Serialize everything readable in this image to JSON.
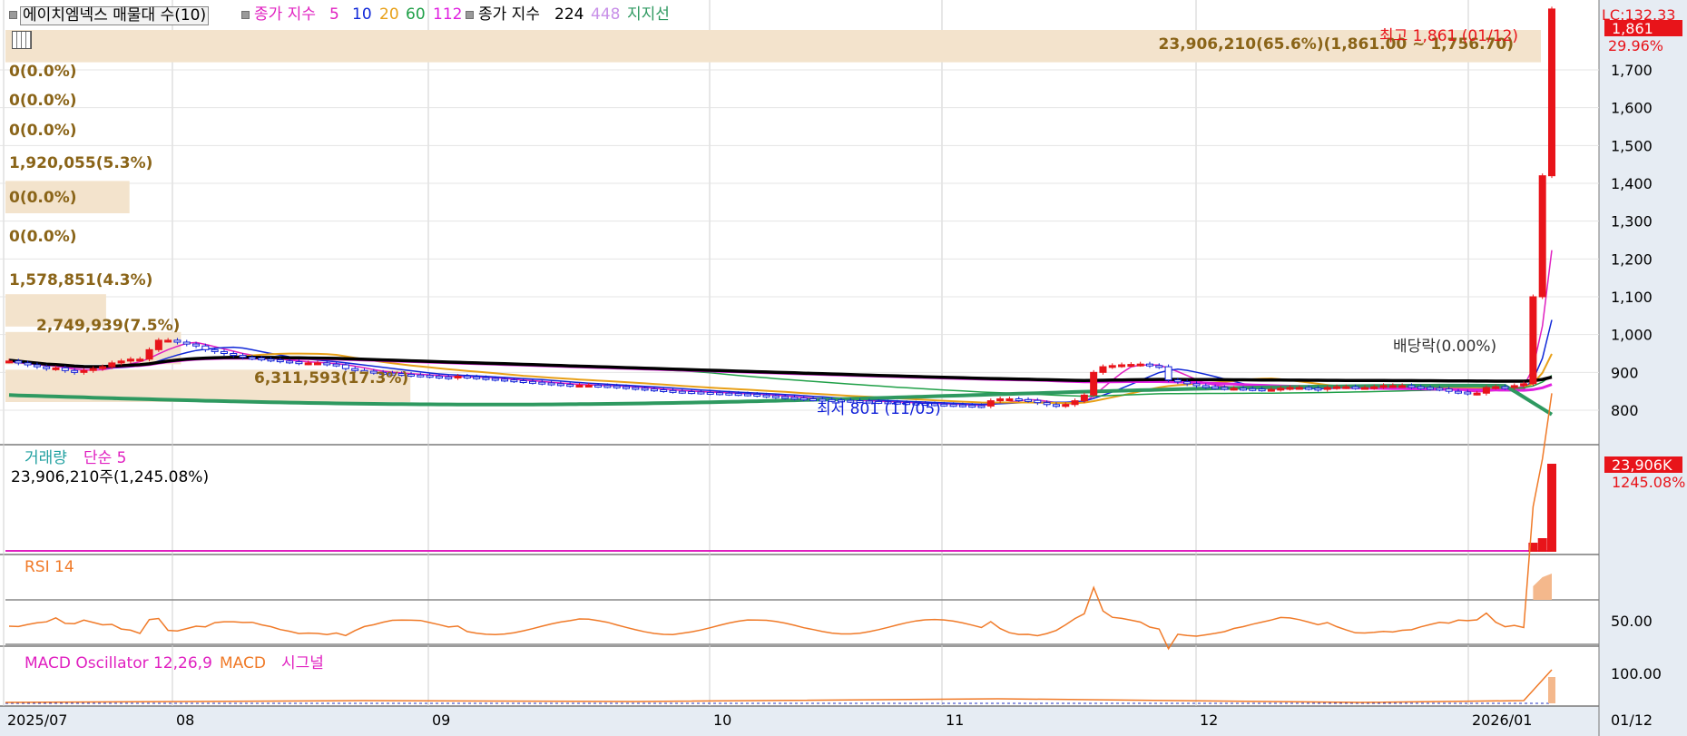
{
  "colors": {
    "up": "#e8141a",
    "down": "#1020d8",
    "ma5": "#e020c0",
    "ma10": "#1028d8",
    "ma20": "#e8a018",
    "ma60": "#20a048",
    "ma112": "#e020e0",
    "ma224": "#000000",
    "ma448": "#c890e8",
    "support": "#2e9960",
    "volbar": "#f3e3cc",
    "volbar_text": "#8a6418",
    "axis_bg": "#e6ecf3",
    "rsi": "#f07a28",
    "macd": "#f07a28"
  },
  "legend": {
    "stock_name": "에이치엠넥스 매물대 수(10)",
    "ma_label": "종가 지수",
    "ma_periods": [
      "5",
      "10",
      "20",
      "60",
      "112"
    ],
    "ma2_label": "종가 지수",
    "ma2_periods": [
      "224",
      "448"
    ],
    "support_label": "지지선"
  },
  "price_axis": {
    "lc": "LC:132.33",
    "last_price": "1,861",
    "last_change": "29.96%",
    "ticks": [
      "1,700",
      "1,600",
      "1,500",
      "1,400",
      "1,300",
      "1,200",
      "1,100",
      "1,000",
      "900",
      "800"
    ]
  },
  "annotations": {
    "high": "최고 1,861 (01/12)",
    "low": "최저 801 (11/05)",
    "dividend": "배당락(0.00%)"
  },
  "volume_profile": [
    {
      "text": "23,906,210(65.6%)(1,861.00 ~ 1,756.70)",
      "pct": 65.6
    },
    {
      "text": "0(0.0%)",
      "pct": 0
    },
    {
      "text": "0(0.0%)",
      "pct": 0
    },
    {
      "text": "0(0.0%)",
      "pct": 0
    },
    {
      "text": "1,920,055(5.3%)",
      "pct": 5.3
    },
    {
      "text": "0(0.0%)",
      "pct": 0
    },
    {
      "text": "0(0.0%)",
      "pct": 0
    },
    {
      "text": "1,578,851(4.3%)",
      "pct": 4.3
    },
    {
      "text": "2,749,939(7.5%)",
      "pct": 7.5
    },
    {
      "text": "6,311,593(17.3%)",
      "pct": 17.3
    }
  ],
  "volume_panel": {
    "label": "거래량",
    "ma_label": "단순 5",
    "value_text": "23,906,210주(1,245.08%)",
    "axis_value": "23,906K",
    "axis_pct": "1245.08%"
  },
  "rsi_panel": {
    "label": "RSI 14",
    "tick": "50.00"
  },
  "macd_panel": {
    "label": "MACD Oscillator 12,26,9",
    "macd_label": "MACD",
    "signal_label": "시그널",
    "tick": "100.00"
  },
  "x_axis": {
    "labels": [
      "2025/07",
      "08",
      "09",
      "10",
      "11",
      "12",
      "2026/01"
    ],
    "cursor_label": "01/12"
  },
  "chart_data": {
    "type": "candlestick",
    "title": "에이치엠넥스 매물대 수(10)",
    "ylim": [
      760,
      1880
    ],
    "months": [
      "2025/07",
      "08",
      "09",
      "10",
      "11",
      "12",
      "2026/01"
    ],
    "high": {
      "value": 1861,
      "date": "01/12"
    },
    "low": {
      "value": 801,
      "date": "11/05"
    },
    "last_close": 1861,
    "series_close": [
      930,
      925,
      920,
      915,
      910,
      912,
      905,
      900,
      905,
      910,
      915,
      925,
      930,
      935,
      935,
      960,
      985,
      985,
      980,
      975,
      970,
      960,
      955,
      950,
      945,
      940,
      938,
      935,
      933,
      930,
      928,
      925,
      925,
      925,
      922,
      920,
      910,
      905,
      903,
      900,
      898,
      897,
      895,
      893,
      892,
      890,
      888,
      886,
      890,
      888,
      886,
      884,
      882,
      880,
      878,
      876,
      874,
      872,
      870,
      868,
      866,
      866,
      866,
      865,
      864,
      862,
      860,
      858,
      856,
      854,
      852,
      850,
      849,
      848,
      847,
      846,
      845,
      844,
      843,
      842,
      840,
      838,
      836,
      834,
      832,
      830,
      829,
      828,
      827,
      826,
      825,
      824,
      823,
      822,
      821,
      820,
      819,
      818,
      817,
      816,
      815,
      814,
      813,
      812,
      811,
      825,
      830,
      830,
      828,
      826,
      820,
      815,
      812,
      815,
      825,
      840,
      900,
      915,
      918,
      920,
      921,
      922,
      918,
      915,
      880,
      875,
      870,
      865,
      862,
      860,
      858,
      858,
      857,
      856,
      855,
      855,
      858,
      860,
      860,
      858,
      855,
      860,
      862,
      862,
      860,
      860,
      862,
      865,
      865,
      865,
      862,
      860,
      858,
      856,
      850,
      848,
      845,
      845,
      860,
      862,
      860,
      865,
      870,
      1100,
      1420,
      1861
    ],
    "volume_profile_pct": [
      65.6,
      0,
      0,
      0,
      5.3,
      0,
      0,
      4.3,
      7.5,
      17.3
    ]
  }
}
